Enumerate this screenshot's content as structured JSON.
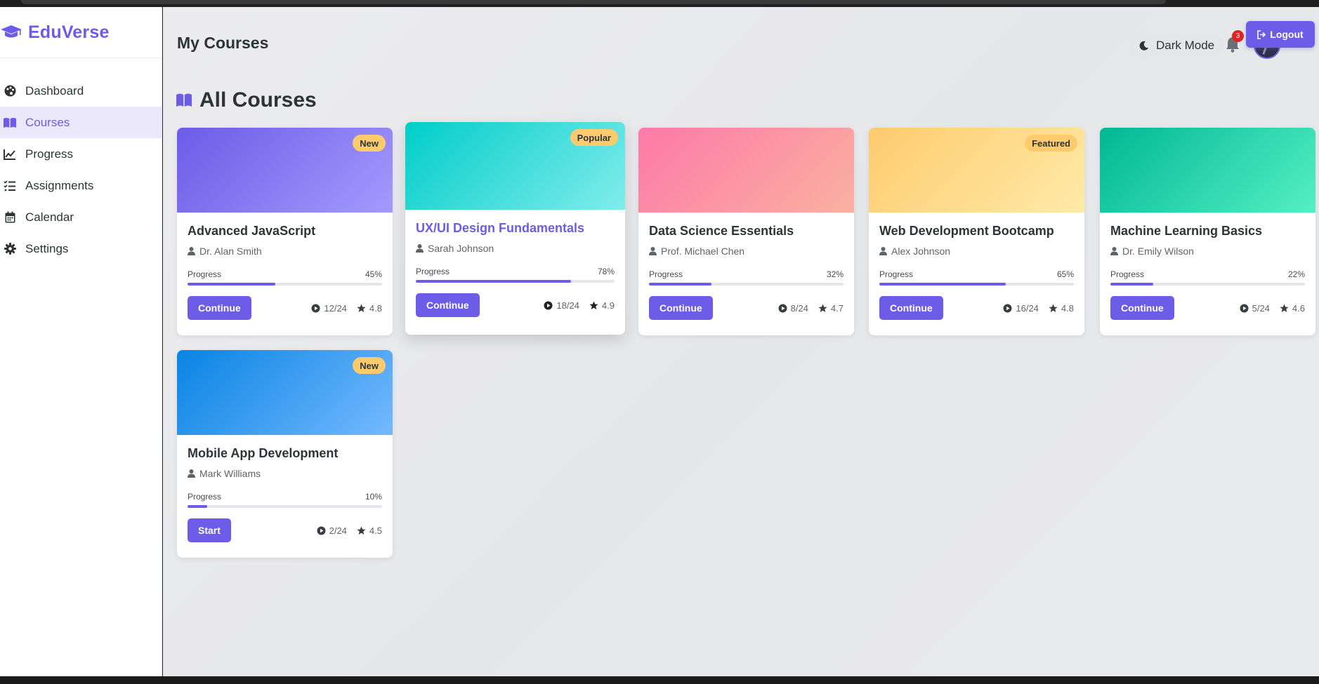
{
  "brand": {
    "name": "EduVerse"
  },
  "sidebar": {
    "items": [
      {
        "label": "Dashboard",
        "icon": "palette-icon"
      },
      {
        "label": "Courses",
        "icon": "book-icon",
        "active": true
      },
      {
        "label": "Progress",
        "icon": "chart-line-icon"
      },
      {
        "label": "Assignments",
        "icon": "list-check-icon"
      },
      {
        "label": "Calendar",
        "icon": "calendar-icon"
      },
      {
        "label": "Settings",
        "icon": "gear-icon"
      }
    ]
  },
  "header": {
    "title": "My Courses",
    "dark_mode_label": "Dark Mode",
    "notification_count": "3",
    "logout_label": "Logout"
  },
  "section": {
    "title": "All Courses"
  },
  "colors": {
    "accent": "#6c5ce7",
    "badge": "#fdcb6e",
    "notification": "#e02424"
  },
  "progress_label": "Progress",
  "courses": [
    {
      "title": "Advanced JavaScript",
      "instructor": "Dr. Alan Smith",
      "progress": 45,
      "progress_text": "45%",
      "button": "Continue",
      "lessons": "12/24",
      "rating": "4.8",
      "badge": "New",
      "gradient": [
        "#6c5ce7",
        "#a29bfe"
      ]
    },
    {
      "title": "UX/UI Design Fundamentals",
      "instructor": "Sarah Johnson",
      "progress": 78,
      "progress_text": "78%",
      "button": "Continue",
      "lessons": "18/24",
      "rating": "4.9",
      "badge": "Popular",
      "gradient": [
        "#00cec9",
        "#81ecec"
      ]
    },
    {
      "title": "Data Science Essentials",
      "instructor": "Prof. Michael Chen",
      "progress": 32,
      "progress_text": "32%",
      "button": "Continue",
      "lessons": "8/24",
      "rating": "4.7",
      "badge": "",
      "gradient": [
        "#fd79a8",
        "#fab1a0"
      ]
    },
    {
      "title": "Web Development Bootcamp",
      "instructor": "Alex Johnson",
      "progress": 65,
      "progress_text": "65%",
      "button": "Continue",
      "lessons": "16/24",
      "rating": "4.8",
      "badge": "Featured",
      "gradient": [
        "#fdcb6e",
        "#ffeaa7"
      ]
    },
    {
      "title": "Machine Learning Basics",
      "instructor": "Dr. Emily Wilson",
      "progress": 22,
      "progress_text": "22%",
      "button": "Continue",
      "lessons": "5/24",
      "rating": "4.6",
      "badge": "",
      "gradient": [
        "#00b894",
        "#55efc4"
      ]
    },
    {
      "title": "Mobile App Development",
      "instructor": "Mark Williams",
      "progress": 10,
      "progress_text": "10%",
      "button": "Start",
      "lessons": "2/24",
      "rating": "4.5",
      "badge": "New",
      "gradient": [
        "#0984e3",
        "#74b9ff"
      ]
    }
  ]
}
